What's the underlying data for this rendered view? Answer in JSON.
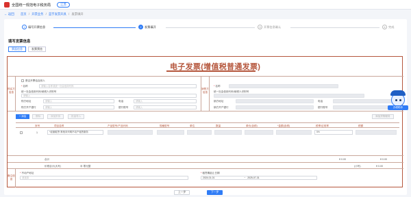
{
  "app": {
    "title": "全国统一规范电子税务局",
    "region": "江苏"
  },
  "crumbs": {
    "back": "返回",
    "items": [
      "首页",
      "/",
      "开票业务",
      "/",
      "蓝字发票开具",
      "/",
      "发票填开"
    ]
  },
  "steps": [
    {
      "num": "1",
      "label": "填写开票信息",
      "state": "done"
    },
    {
      "num": "2",
      "label": "发票填开",
      "state": "active"
    },
    {
      "num": "3",
      "label": "开票信息确认",
      "state": "todo"
    },
    {
      "num": "4",
      "label": "完成",
      "state": "todo"
    }
  ],
  "section_title": "填写发票信息",
  "tabs": [
    {
      "label": "票面信息",
      "active": true
    },
    {
      "label": "发票预览",
      "active": false
    }
  ],
  "invoice": {
    "title": "电子发票(增值税普通发票)",
    "buyer": {
      "side": "购买方信息",
      "natural_person": "是否开票给自然人",
      "name_label": "名称",
      "name_ph": "请输入名称或统一社会信用代码",
      "tax_label": "统一社会信用代码/纳税人识别号",
      "tax_ph": "请输入",
      "addr_label": "购方地址",
      "addr_ph": "请输入",
      "phone_label": "电话",
      "phone_ph": "请输入",
      "bank_label": "购方开户银行",
      "bank_ph": "请输入",
      "account_label": "银行账号",
      "account_ph": "请输入"
    },
    "seller": {
      "side": "销售方信息",
      "name_label": "名称",
      "tax_label": "统一社会信用代码/纳税人识别号",
      "addr_label": "销方地址",
      "phone_label": "电话",
      "bank_label": "销方开户银行",
      "account_label": "银行账号"
    },
    "toolbar": {
      "add": "+ 添加",
      "delete": "删除",
      "discount": "添加折扣",
      "import": "批量导入",
      "right": "添加货物服务"
    },
    "columns": [
      "序号",
      "项目名称",
      "产品型号/产品代码",
      "规格型号",
      "单位",
      "数量",
      "单价(含税)",
      "*金额(含税)",
      "税率/征收率",
      "税额"
    ],
    "row": {
      "index": "1",
      "name": "*经营租赁*其他未列明不动产租赁服务",
      "rate": "5%"
    },
    "total_label": "合计",
    "total_amount": "¥ 0.00",
    "total_tax": "¥ 0.00",
    "grand_label": "价税合计(大写)",
    "grand_zero": "零元整",
    "grand_small_label": "(小写)",
    "grand_small": "¥ 0.00",
    "remark_side": "备注信息",
    "estate_addr_label": "不动产地址",
    "estate_addr_ph": "请选择",
    "lease_label": "租赁期起止日期",
    "lease_start": "2024-01-01",
    "lease_sep": "~",
    "lease_end": "2025-07-31"
  },
  "actions": {
    "prev": "上一步",
    "next": "下一步"
  },
  "assistant": {
    "label": "办税助手"
  },
  "colors": {
    "accent": "#2f7cf6",
    "invoice_red": "#b5563c"
  }
}
